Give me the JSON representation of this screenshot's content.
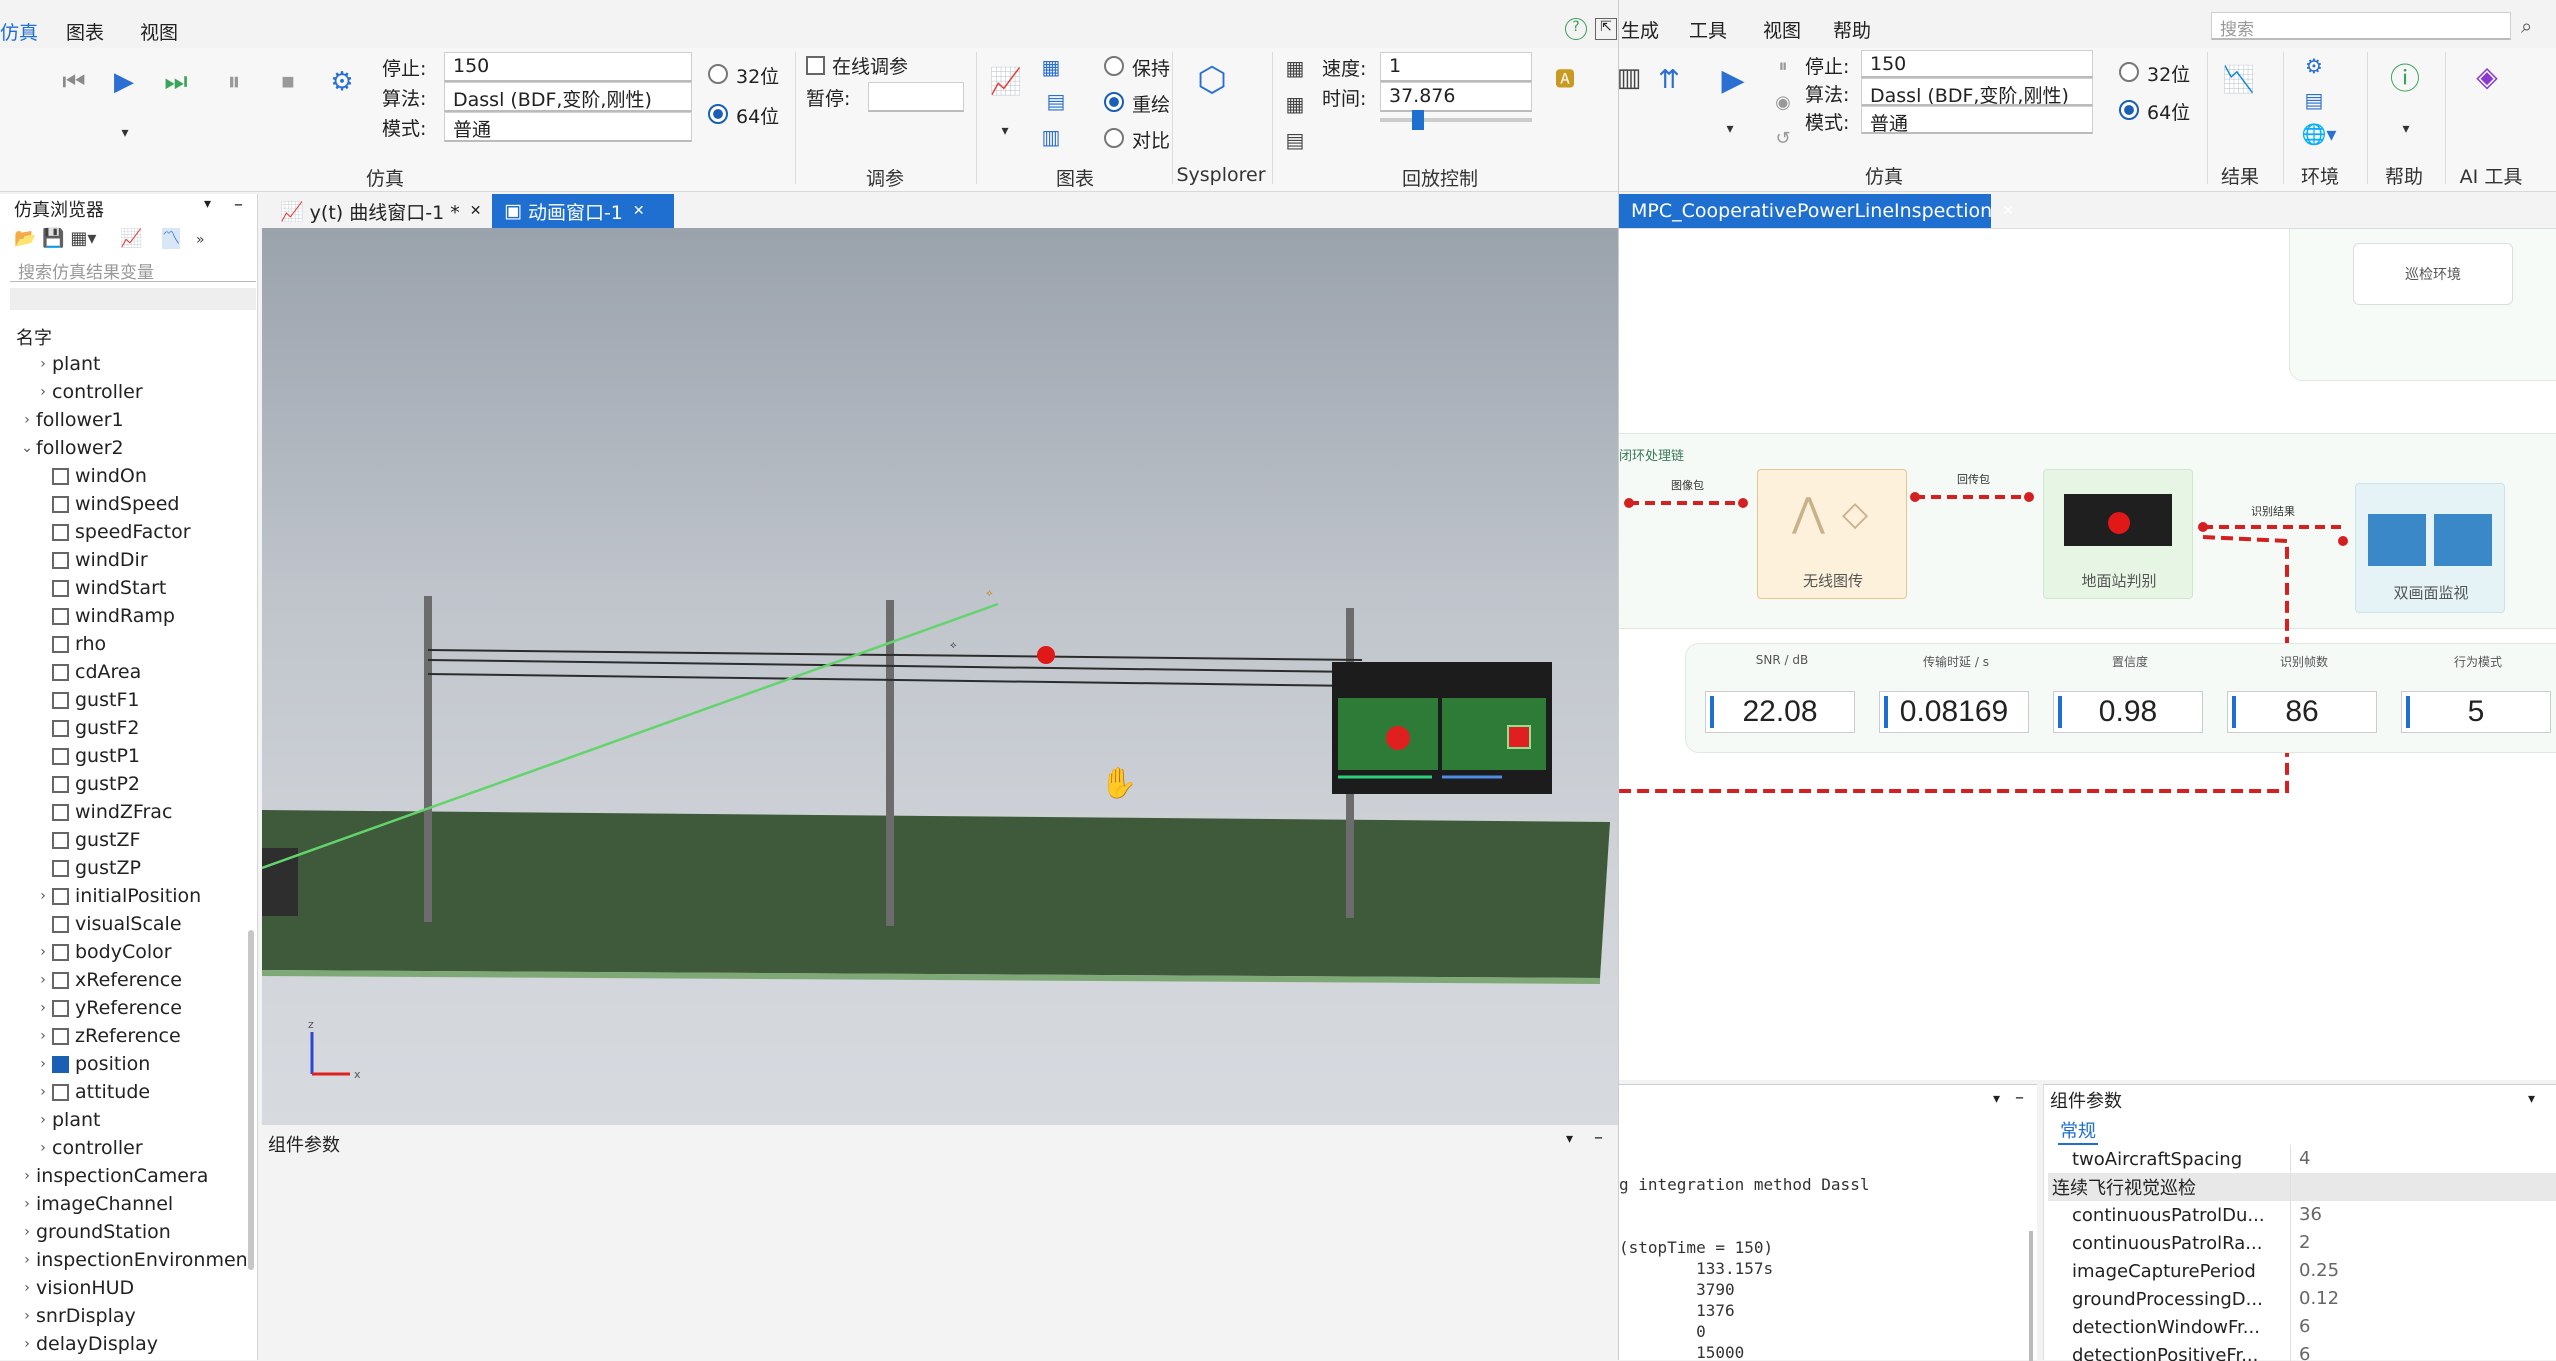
{
  "left_app": {
    "menu": [
      "仿真",
      "图表",
      "视图"
    ],
    "sim": {
      "stop_label": "停止:",
      "stop_value": "150",
      "algo_label": "算法:",
      "algo_value": "Dassl (BDF,变阶,刚性)",
      "mode_label": "模式:",
      "mode_value": "普通",
      "bit32": "32位",
      "bit64": "64位",
      "group": "仿真"
    },
    "tune": {
      "online_label": "在线调参",
      "pause_label": "暂停:",
      "pause_value": "",
      "group": "调参"
    },
    "chart": {
      "keep": "保持",
      "redraw": "重绘",
      "compare": "对比",
      "group": "图表"
    },
    "sysplorer": {
      "group": "Sysplorer"
    },
    "playback": {
      "speed_label": "速度:",
      "speed_value": "1",
      "time_label": "时间:",
      "time_value": "37.876",
      "group": "回放控制",
      "progress": 0.25
    },
    "browser": {
      "title": "仿真浏览器",
      "search_placeholder": "搜索仿真结果变量",
      "header": "名字",
      "items": [
        {
          "indent": 1,
          "caret": ">",
          "check": null,
          "label": "plant"
        },
        {
          "indent": 1,
          "caret": ">",
          "check": null,
          "label": "controller"
        },
        {
          "indent": 0,
          "caret": ">",
          "check": null,
          "label": "follower1"
        },
        {
          "indent": 0,
          "caret": "v",
          "check": null,
          "label": "follower2"
        },
        {
          "indent": 1,
          "caret": "",
          "check": false,
          "label": "windOn"
        },
        {
          "indent": 1,
          "caret": "",
          "check": false,
          "label": "windSpeed"
        },
        {
          "indent": 1,
          "caret": "",
          "check": false,
          "label": "speedFactor"
        },
        {
          "indent": 1,
          "caret": "",
          "check": false,
          "label": "windDir"
        },
        {
          "indent": 1,
          "caret": "",
          "check": false,
          "label": "windStart"
        },
        {
          "indent": 1,
          "caret": "",
          "check": false,
          "label": "windRamp"
        },
        {
          "indent": 1,
          "caret": "",
          "check": false,
          "label": "rho"
        },
        {
          "indent": 1,
          "caret": "",
          "check": false,
          "label": "cdArea"
        },
        {
          "indent": 1,
          "caret": "",
          "check": false,
          "label": "gustF1"
        },
        {
          "indent": 1,
          "caret": "",
          "check": false,
          "label": "gustF2"
        },
        {
          "indent": 1,
          "caret": "",
          "check": false,
          "label": "gustP1"
        },
        {
          "indent": 1,
          "caret": "",
          "check": false,
          "label": "gustP2"
        },
        {
          "indent": 1,
          "caret": "",
          "check": false,
          "label": "windZFrac"
        },
        {
          "indent": 1,
          "caret": "",
          "check": false,
          "label": "gustZF"
        },
        {
          "indent": 1,
          "caret": "",
          "check": false,
          "label": "gustZP"
        },
        {
          "indent": 1,
          "caret": ">",
          "check": false,
          "label": "initialPosition"
        },
        {
          "indent": 1,
          "caret": "",
          "check": false,
          "label": "visualScale"
        },
        {
          "indent": 1,
          "caret": ">",
          "check": false,
          "label": "bodyColor"
        },
        {
          "indent": 1,
          "caret": ">",
          "check": false,
          "label": "xReference"
        },
        {
          "indent": 1,
          "caret": ">",
          "check": false,
          "label": "yReference"
        },
        {
          "indent": 1,
          "caret": ">",
          "check": false,
          "label": "zReference"
        },
        {
          "indent": 1,
          "caret": ">",
          "check": true,
          "label": "position"
        },
        {
          "indent": 1,
          "caret": ">",
          "check": false,
          "label": "attitude"
        },
        {
          "indent": 1,
          "caret": ">",
          "check": null,
          "label": "plant"
        },
        {
          "indent": 1,
          "caret": ">",
          "check": null,
          "label": "controller"
        },
        {
          "indent": 0,
          "caret": ">",
          "check": null,
          "label": "inspectionCamera"
        },
        {
          "indent": 0,
          "caret": ">",
          "check": null,
          "label": "imageChannel"
        },
        {
          "indent": 0,
          "caret": ">",
          "check": null,
          "label": "groundStation"
        },
        {
          "indent": 0,
          "caret": ">",
          "check": null,
          "label": "inspectionEnvironment"
        },
        {
          "indent": 0,
          "caret": ">",
          "check": null,
          "label": "visionHUD"
        },
        {
          "indent": 0,
          "caret": ">",
          "check": null,
          "label": "snrDisplay"
        },
        {
          "indent": 0,
          "caret": ">",
          "check": null,
          "label": "delayDisplay"
        }
      ]
    },
    "tabs": [
      {
        "label": "y(t) 曲线窗口-1 *",
        "active": false
      },
      {
        "label": "动画窗口-1",
        "active": true
      }
    ],
    "bottom_panel_title": "组件参数"
  },
  "right_app": {
    "menu": [
      "生成",
      "工具",
      "视图",
      "帮助"
    ],
    "search_placeholder": "搜索",
    "sim": {
      "stop_label": "停止:",
      "stop_value": "150",
      "algo_label": "算法:",
      "algo_value": "Dassl (BDF,变阶,刚性)",
      "mode_label": "模式:",
      "mode_value": "普通",
      "bit32": "32位",
      "bit64": "64位",
      "group": "仿真"
    },
    "groups": [
      "结果",
      "环境",
      "帮助",
      "AI 工具"
    ],
    "tab": "MPC_CooperativePowerLineInspection",
    "diagram": {
      "env_label": "巡检环境",
      "section_label": "闭环处理链",
      "link1": "图像包",
      "link2": "回传包",
      "link3": "识别结果",
      "block1": "无线图传",
      "block2": "地面站判别",
      "block3": "双画面监视",
      "metrics": [
        {
          "title": "SNR / dB",
          "value": "22.08"
        },
        {
          "title": "传输时延 / s",
          "value": "0.08169"
        },
        {
          "title": "置信度",
          "value": "0.98"
        },
        {
          "title": "识别帧数",
          "value": "86"
        },
        {
          "title": "行为模式",
          "value": "5"
        }
      ]
    },
    "output_lines": [
      "g integration method Dassl",
      "",
      "",
      "(stopTime = 150)",
      "        133.157s",
      "        3790",
      "        1376",
      "        0",
      "        15000"
    ],
    "params": {
      "title": "组件参数",
      "tab": "常规",
      "rows": [
        {
          "name": "twoAircraftSpacing",
          "value": "4",
          "section": false
        },
        {
          "name": "连续飞行视觉巡检",
          "value": "",
          "section": true
        },
        {
          "name": "continuousPatrolDu...",
          "value": "36",
          "section": false
        },
        {
          "name": "continuousPatrolRa...",
          "value": "2",
          "section": false
        },
        {
          "name": "imageCapturePeriod",
          "value": "0.25",
          "section": false
        },
        {
          "name": "groundProcessingD...",
          "value": "0.12",
          "section": false
        },
        {
          "name": "detectionWindowFr...",
          "value": "6",
          "section": false
        },
        {
          "name": "detectionPositiveFr...",
          "value": "6",
          "section": false
        }
      ]
    }
  },
  "colors": {
    "accent": "#1e6fd0",
    "ground": "#3f5a3a",
    "wire_red": "#d42020"
  }
}
